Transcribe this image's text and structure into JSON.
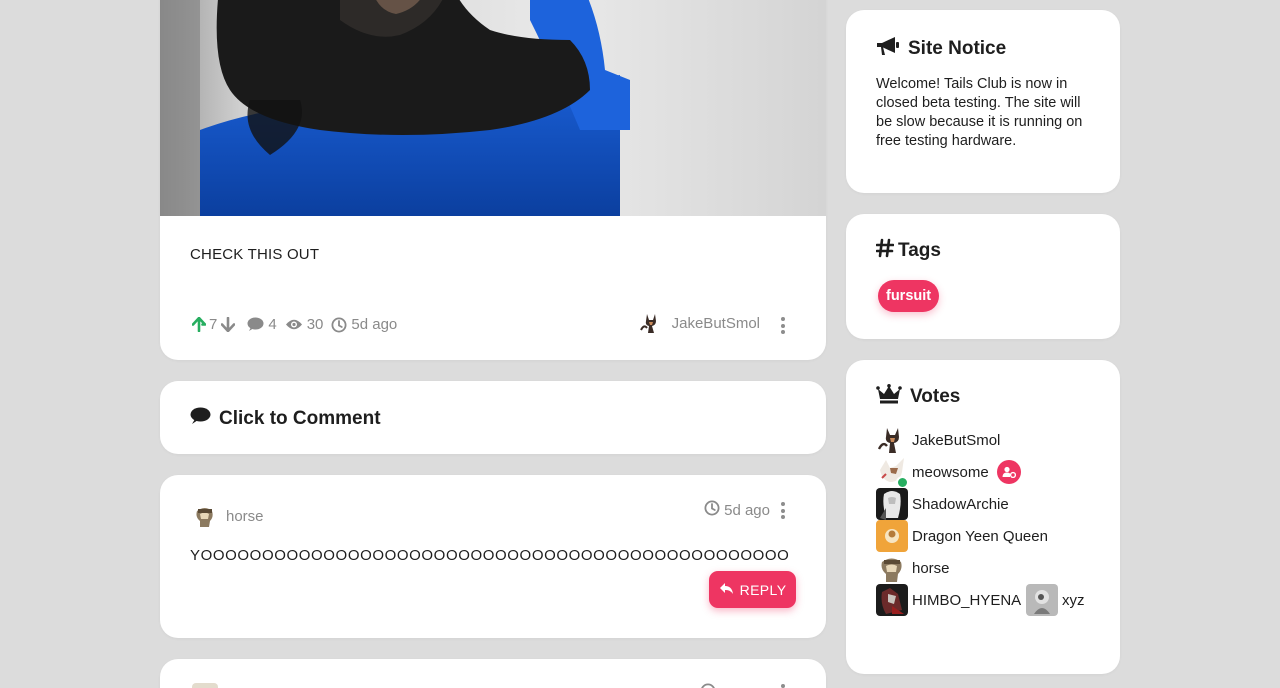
{
  "post": {
    "text": "CHECK THIS OUT",
    "upvotes": "7",
    "comments": "4",
    "views": "30",
    "age": "5d ago",
    "author": "JakeButSmol"
  },
  "comment_cta": {
    "label": "Click to Comment"
  },
  "comments": [
    {
      "user": "horse",
      "age": "5d ago",
      "body": "YOOOOOOOOOOOOOOOOOOOOOOOOOOOOOOOOOOOOOOOOOOOOOOOO",
      "reply_label": "REPLY"
    }
  ],
  "sidebar": {
    "notice": {
      "title": "Site Notice",
      "text": "Welcome! Tails Club is now in closed beta testing. The site will be slow because it is running on free testing hardware."
    },
    "tags": {
      "title": "Tags",
      "items": [
        "fursuit"
      ]
    },
    "votes": {
      "title": "Votes",
      "users": [
        "JakeButSmol",
        "meowsome",
        "ShadowArchie",
        "Dragon Yeen Queen",
        "horse",
        "HIMBO_HYENA",
        "xyz"
      ]
    }
  },
  "icons": {
    "upvote": "arrow-up-icon",
    "downvote": "arrow-down-icon",
    "comments": "speech-bubble-icon",
    "views": "eye-icon",
    "time": "clock-icon",
    "menu": "kebab-menu-icon",
    "reply": "reply-arrow-icon",
    "notice": "megaphone-icon",
    "tags": "hashtag-icon",
    "votes": "crown-icon",
    "moderator": "user-gear-icon"
  },
  "colors": {
    "accent": "#ee3562",
    "upvote": "#27ae60",
    "online": "#27ae60",
    "muted_text": "#8a8a8a"
  }
}
